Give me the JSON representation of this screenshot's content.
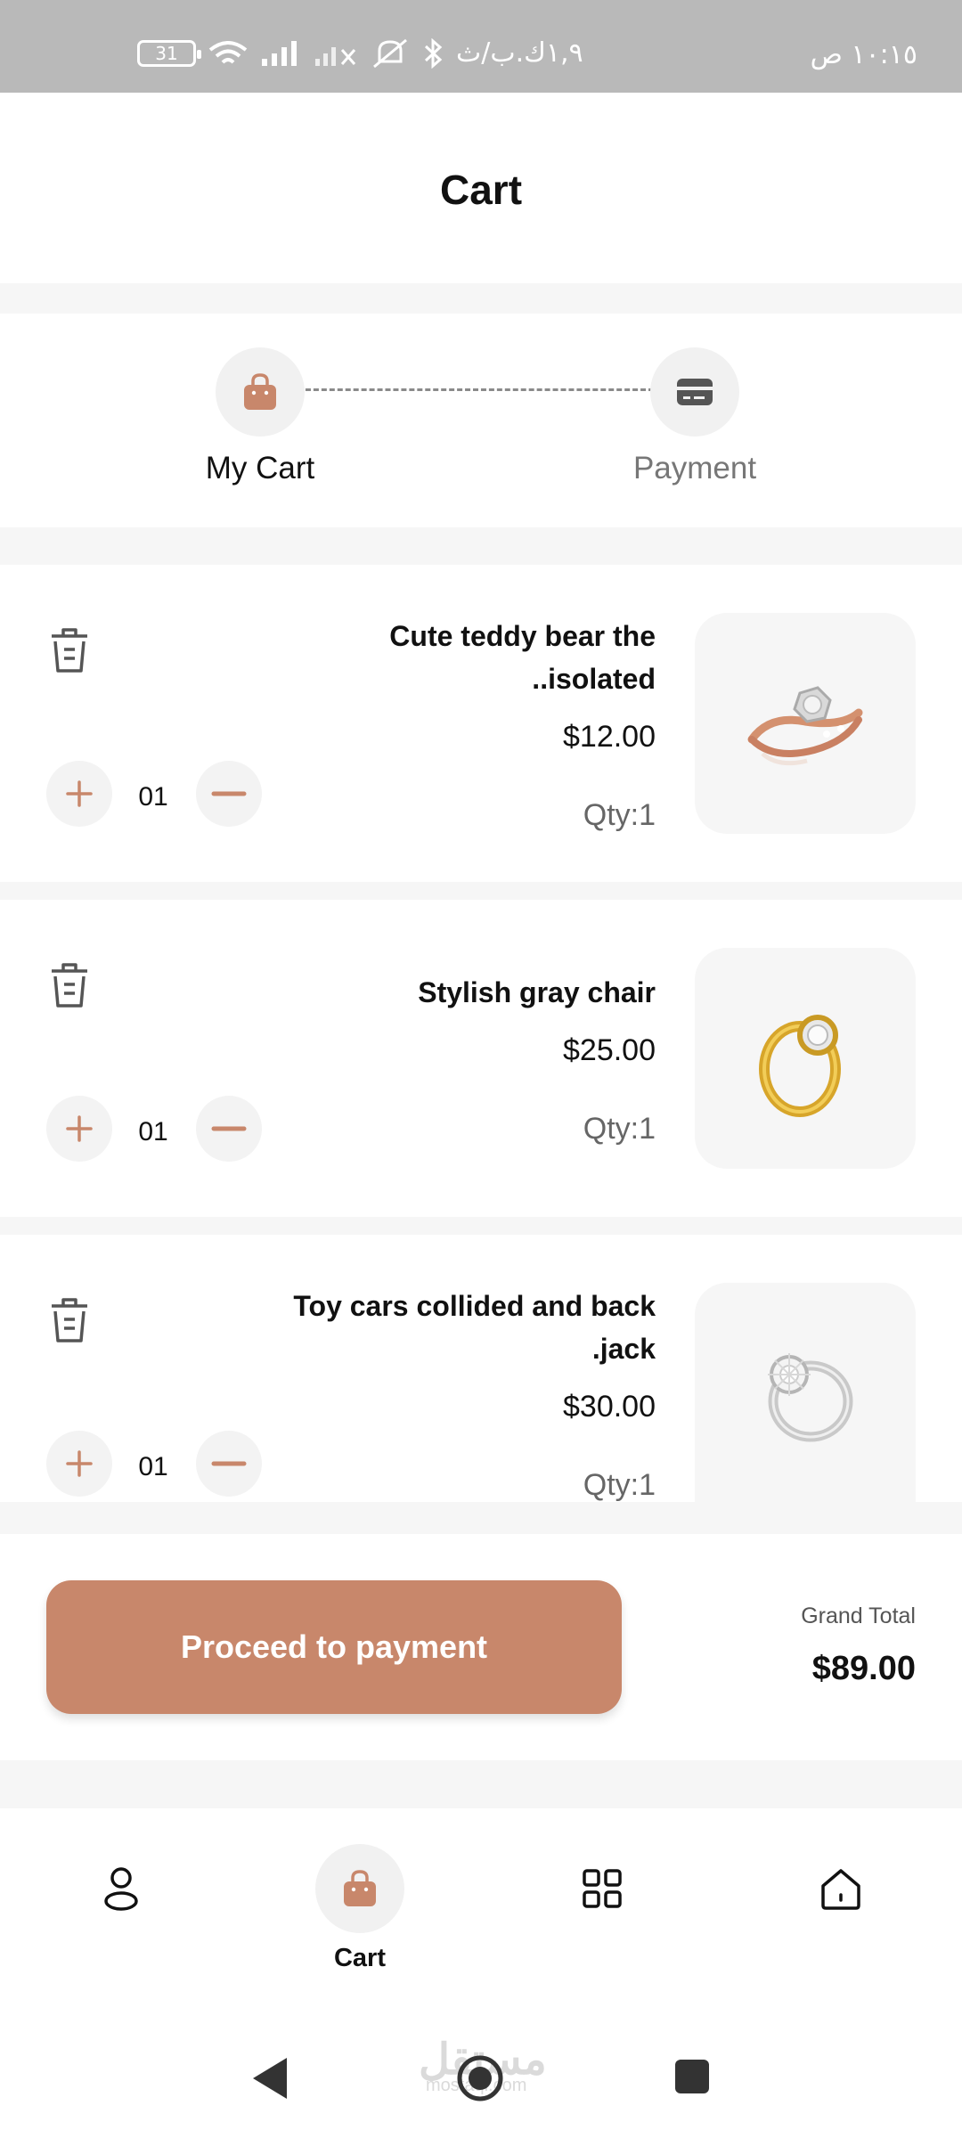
{
  "status_bar": {
    "time": "١٠:١٥ ص",
    "speed": "١,٩ك.ب/ث",
    "battery": "31"
  },
  "header": {
    "title": "Cart"
  },
  "stepper": {
    "steps": [
      {
        "label": "My Cart",
        "icon": "shopping-bag-icon",
        "active": true
      },
      {
        "label": "Payment",
        "icon": "credit-card-icon",
        "active": false
      }
    ]
  },
  "cart": {
    "items": [
      {
        "name": "Cute teddy bear the ..isolated",
        "price": "$12.00",
        "qty_label": "Qty:1",
        "qty_value": "01",
        "image": "rose-gold-ring"
      },
      {
        "name": "Stylish gray chair",
        "price": "$25.00",
        "qty_label": "Qty:1",
        "qty_value": "01",
        "image": "gold-ring"
      },
      {
        "name": "Toy cars collided and back .jack",
        "price": "$30.00",
        "qty_label": "Qty:1",
        "qty_value": "01",
        "image": "silver-ring"
      }
    ]
  },
  "checkout": {
    "button_label": "Proceed to payment",
    "grand_total_label": "Grand Total",
    "grand_total_value": "$89.00"
  },
  "bottom_nav": {
    "items": [
      {
        "name": "profile",
        "icon": "user-icon"
      },
      {
        "name": "cart",
        "icon": "shopping-bag-icon",
        "label": "Cart",
        "active": true
      },
      {
        "name": "categories",
        "icon": "grid-icon"
      },
      {
        "name": "home",
        "icon": "home-icon"
      }
    ]
  },
  "watermark": {
    "text": "مستقل",
    "sub": "mostaql.com"
  },
  "colors": {
    "accent": "#c8876b",
    "status_bar": "#b9b9b9",
    "background": "#f6f6f6"
  }
}
